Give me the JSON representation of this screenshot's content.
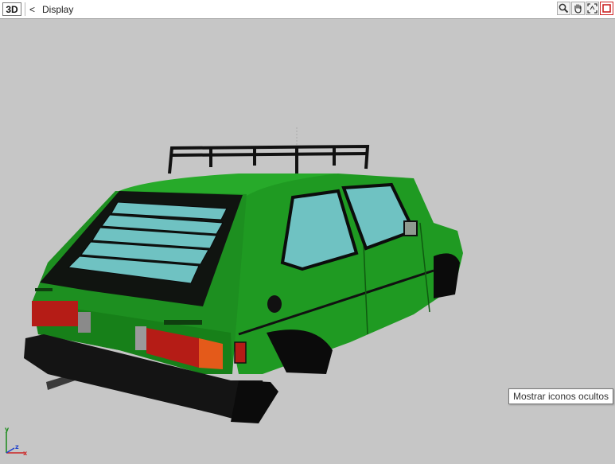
{
  "toolbar": {
    "mode_label": "3D",
    "back_label": "<",
    "title": "Display"
  },
  "tools": [
    {
      "icon": "zoom-icon"
    },
    {
      "icon": "pan-hand-icon"
    },
    {
      "icon": "fit-view-icon"
    },
    {
      "icon": "close-view-icon"
    }
  ],
  "tooltip": {
    "text": "Mostrar iconos ocultos"
  },
  "axis": {
    "y_label": "y",
    "z_label": "z",
    "x_label": "x"
  },
  "colors": {
    "background": "#c6c6c6",
    "car_body": "#1f9a22",
    "glass": "#6fc2c2",
    "tail_light": "#b51c16",
    "bumper": "#141414",
    "axis_y": "#1a8a1a",
    "axis_z": "#2244cc",
    "axis_x": "#cc2222"
  }
}
